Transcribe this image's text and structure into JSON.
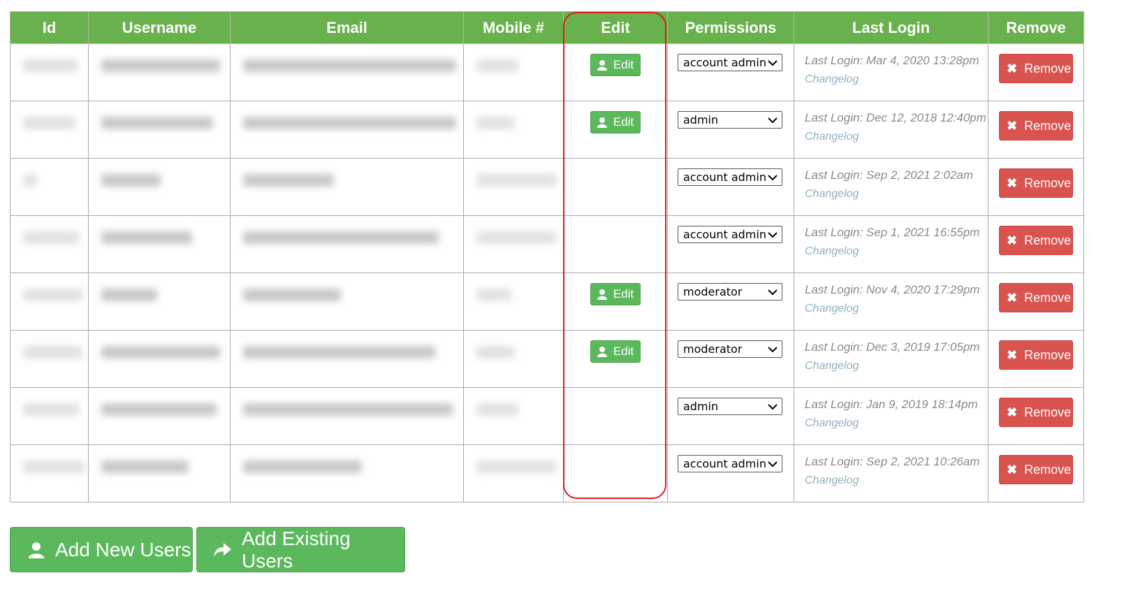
{
  "table": {
    "headers": [
      "Id",
      "Username",
      "Email",
      "Mobile #",
      "Edit",
      "Permissions",
      "Last Login",
      "Remove"
    ],
    "edit_label": "Edit",
    "remove_label": "Remove",
    "changelog_label": "Changelog",
    "rows": [
      {
        "permission": "account admin",
        "last_login": "Last Login: Mar 4, 2020 13:28pm",
        "has_edit": true
      },
      {
        "permission": "admin",
        "last_login": "Last Login: Dec 12, 2018 12:40pm",
        "has_edit": true
      },
      {
        "permission": "account admin",
        "last_login": "Last Login: Sep 2, 2021 2:02am",
        "has_edit": false
      },
      {
        "permission": "account admin",
        "last_login": "Last Login: Sep 1, 2021 16:55pm",
        "has_edit": false
      },
      {
        "permission": "moderator",
        "last_login": "Last Login: Nov 4, 2020 17:29pm",
        "has_edit": true
      },
      {
        "permission": "moderator",
        "last_login": "Last Login: Dec 3, 2019 17:05pm",
        "has_edit": true
      },
      {
        "permission": "admin",
        "last_login": "Last Login: Jan 9, 2019 18:14pm",
        "has_edit": false
      },
      {
        "permission": "account admin",
        "last_login": "Last Login: Sep 2, 2021 10:26am",
        "has_edit": false
      }
    ]
  },
  "actions": {
    "add_new_users": "Add New Users",
    "add_existing_users": "Add Existing Users"
  },
  "colors": {
    "header_green": "#68b14c",
    "button_green": "#5cb85c",
    "remove_red": "#d9534f",
    "highlight_red": "#e01919"
  }
}
